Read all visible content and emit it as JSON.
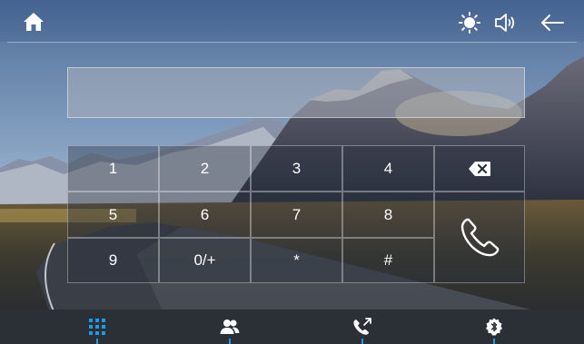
{
  "colors": {
    "accent": "#1e9be8",
    "icon": "#ffffff",
    "bottom_bar": "#2b2f36"
  },
  "topbar": {
    "home_icon": "home-icon",
    "brightness_icon": "brightness-icon",
    "volume_icon": "volume-icon",
    "back_icon": "back-arrow-icon"
  },
  "dialer": {
    "number": "",
    "keys": {
      "k1": "1",
      "k2": "2",
      "k3": "3",
      "k4": "4",
      "k5": "5",
      "k6": "6",
      "k7": "7",
      "k8": "8",
      "k9": "9",
      "k0": "0/+",
      "star": "*",
      "hash": "#"
    },
    "backspace_icon": "backspace-icon",
    "call_icon": "phone-call-icon"
  },
  "tabs": [
    {
      "icon": "dialpad-icon",
      "active": true
    },
    {
      "icon": "contacts-icon",
      "active": false
    },
    {
      "icon": "call-log-icon",
      "active": false
    },
    {
      "icon": "bluetooth-settings-icon",
      "active": false
    }
  ]
}
